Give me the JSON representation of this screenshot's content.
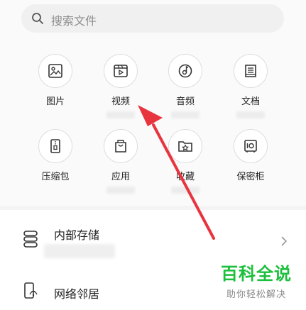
{
  "search": {
    "placeholder": "搜索文件"
  },
  "categories": [
    {
      "label": "图片",
      "icon": "image-icon"
    },
    {
      "label": "视频",
      "icon": "video-icon"
    },
    {
      "label": "音频",
      "icon": "audio-icon"
    },
    {
      "label": "文档",
      "icon": "document-icon"
    },
    {
      "label": "压缩包",
      "icon": "zip-icon"
    },
    {
      "label": "应用",
      "icon": "app-bag-icon"
    },
    {
      "label": "收藏",
      "icon": "favorites-folder-icon"
    },
    {
      "label": "保密柜",
      "icon": "safe-icon"
    }
  ],
  "locations": [
    {
      "label": "内部存储",
      "icon": "storage-icon"
    },
    {
      "label": "网络邻居",
      "icon": "network-neighbor-icon"
    }
  ],
  "watermark": {
    "title": "百科全说",
    "subtitle": "助你轻松解决"
  },
  "colors": {
    "arrow": "#e8343e",
    "watermark": "#1bbf3b"
  }
}
